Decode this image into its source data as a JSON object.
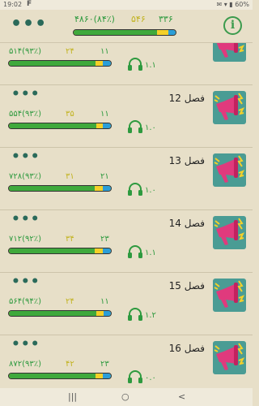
{
  "status_bar": {
    "time": "19:02",
    "app_icon": "F",
    "right": "✉ ▾ ▮ 60%"
  },
  "header": {
    "menu_icon": "•••",
    "info_icon": "i",
    "stats": {
      "total": "۴۸۶۰(۸۴٪)",
      "mid": "۵۴۶",
      "low": "۳۳۶"
    },
    "progress": {
      "green": 0.82,
      "blue": 0.07
    }
  },
  "chapters": [
    {
      "title": "",
      "stats": {
        "total": "۵۱۴(۹۳٪)",
        "mid": "۲۴",
        "low": "۱۱"
      },
      "version": "۱.۱",
      "progress": {
        "green": 0.85,
        "blue": 0.08
      }
    },
    {
      "title": "فصل 12",
      "stats": {
        "total": "۵۵۴(۹۳٪)",
        "mid": "۳۵",
        "low": "۱۱"
      },
      "version": "۱.۰",
      "progress": {
        "green": 0.86,
        "blue": 0.08
      }
    },
    {
      "title": "فصل 13",
      "stats": {
        "total": "۷۲۸(۹۳٪)",
        "mid": "۳۱",
        "low": "۲۱"
      },
      "version": "۱.۰",
      "progress": {
        "green": 0.84,
        "blue": 0.08
      }
    },
    {
      "title": "فصل 14",
      "stats": {
        "total": "۷۱۲(۹۲٪)",
        "mid": "۳۴",
        "low": "۲۳"
      },
      "version": "۱.۱",
      "progress": {
        "green": 0.84,
        "blue": 0.08
      }
    },
    {
      "title": "فصل 15",
      "stats": {
        "total": "۵۶۴(۹۴٪)",
        "mid": "۲۴",
        "low": "۱۱"
      },
      "version": "۱.۲",
      "progress": {
        "green": 0.86,
        "blue": 0.07
      }
    },
    {
      "title": "فصل 16",
      "stats": {
        "total": "۸۷۲(۹۳٪)",
        "mid": "۴۲",
        "low": "۲۳"
      },
      "version": "۰.۰",
      "progress": {
        "green": 0.85,
        "blue": 0.08
      }
    }
  ],
  "icons": {
    "row_menu": "•••",
    "audio": "headphones-icon",
    "thumbnail": "megaphone-icon"
  },
  "nav_bar": {
    "recent": "|||",
    "home": "○",
    "back": "<"
  },
  "colors": {
    "background": "#e7dfc8",
    "green": "#3fa93c",
    "yellow": "#f5d028",
    "blue": "#2b9ed8",
    "thumb_bg": "#4a9c94",
    "megaphone": "#e03a7d"
  }
}
